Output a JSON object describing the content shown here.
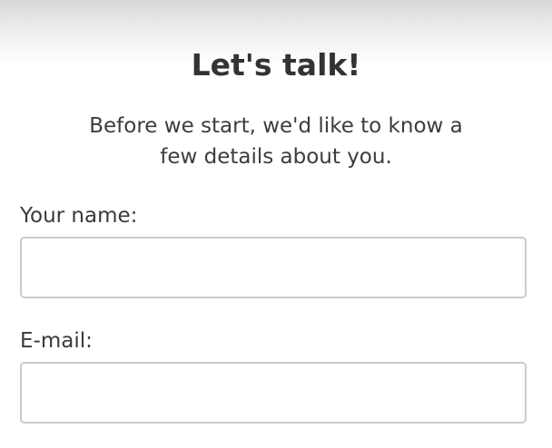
{
  "dialog": {
    "title": "Let's talk!",
    "intro_line1": "Before we start, we'd like to know a",
    "intro_line2": "few details about you."
  },
  "form": {
    "name_label": "Your name:",
    "name_value": "",
    "name_placeholder": "",
    "email_label": "E-mail:",
    "email_value": "",
    "email_placeholder": ""
  }
}
